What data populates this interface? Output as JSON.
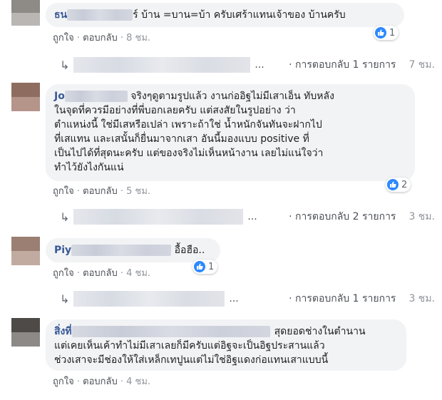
{
  "comments": [
    {
      "author": "ธน",
      "text": "ร์ บ้าน =บาน=บ้า ครับเศร้าแทนเจ้าของ บ้านครับ",
      "reactions": "1",
      "actions": {
        "like": "ถูกใจ",
        "reply": "ตอบกลับ",
        "time": "8 ชม."
      },
      "replies": {
        "ellipsis": "...",
        "summary": "· การตอบกลับ 1 รายการ",
        "time": "7 ชม."
      }
    },
    {
      "author": "Jo",
      "lines": [
        "จริงๆดูตามรูปแล้ว งานก่ออิฐไม่มีเสาเอ็น ทับหลัง",
        "ในจุดที่ควรมีอย่างที่พี่บอกเลยครับ แต่สงสัยในรูปอย่าง ว่า",
        "ตำแหน่งนี้ ใช่มีเสหรือเปล่า เพราะถ้าใช่ น้ำหนักจันทันจะฝากไป",
        "ที่เสแทน และเสนั้นก็ยื่นมาจากเสา อันนี้มองแบบ positive ที่",
        "เป็นไปได้ที่สุดนะครับ แต่ของจริงไม่เห็นหน้างาน เลยไม่แน่ใจว่า",
        "ทำไว้ยังไงกันแน่"
      ],
      "reactions": "2",
      "actions": {
        "like": "ถูกใจ",
        "reply": "ตอบกลับ",
        "time": "5 ชม."
      },
      "replies": {
        "ellipsis": "...",
        "summary": "· การตอบกลับ 2 รายการ",
        "time": "3 ชม."
      }
    },
    {
      "author": "Piy",
      "text": "อื้อฮือ..",
      "reactions": "1",
      "actions": {
        "like": "ถูกใจ",
        "reply": "ตอบกลับ",
        "time": "4 ชม."
      },
      "replies": {
        "ellipsis": "...",
        "summary": "· การตอบกลับ 1 รายการ",
        "time": "3 ชม."
      }
    },
    {
      "author": "สิ่งที่",
      "first_line": "สุดยอดช่างในตำนาน",
      "lines": [
        "แต่เคยเห็นเค้าทำไม่มีเสาเลยก็มีครับแต่อิฐจะเป็นอิฐประสานแล้ว",
        "ช่วงเสาจะมีช่องให้ใส่เหล็กเทปูนแต่ไม่ใช่อิฐแดงก่อแทนเสาแบบนี้"
      ],
      "actions": {
        "like": "ถูกใจ",
        "reply": "ตอบกลับ",
        "time": "4 ชม."
      }
    }
  ],
  "colors": {
    "like_blue": "#2d88ff",
    "name_blue": "#385898",
    "bubble_bg": "#f2f3f5"
  },
  "icons": {
    "like": "thumbs-up-icon",
    "reply": "reply-arrow-icon"
  }
}
